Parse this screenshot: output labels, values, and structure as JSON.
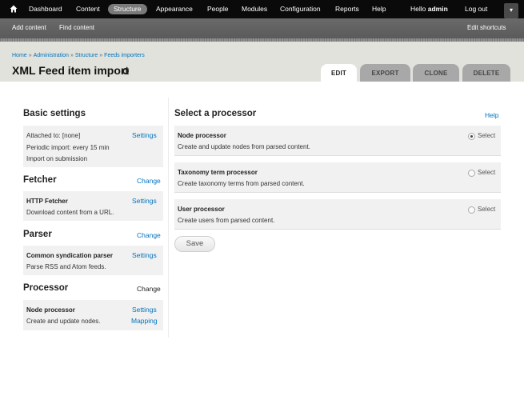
{
  "toolbar": {
    "items": [
      "Dashboard",
      "Content",
      "Structure",
      "Appearance",
      "People",
      "Modules",
      "Configuration",
      "Reports",
      "Help"
    ],
    "greeting_prefix": "Hello ",
    "username": "admin",
    "logout": "Log out",
    "home_icon": "home-icon",
    "toggle_icon": "chevron-down-icon"
  },
  "shortcuts": {
    "items": [
      "Add content",
      "Find content"
    ],
    "edit": "Edit shortcuts"
  },
  "breadcrumb": [
    "Home",
    "Administration",
    "Structure",
    "Feeds importers"
  ],
  "breadcrumb_sep": "»",
  "page_title": "XML Feed item import",
  "tabs": [
    "EDIT",
    "EXPORT",
    "CLONE",
    "DELETE"
  ],
  "basic": {
    "title": "Basic settings",
    "lines": [
      "Attached to: [none]",
      "Periodic import: every 15 min",
      "Import on submission"
    ],
    "settings": "Settings"
  },
  "fetcher": {
    "title": "Fetcher",
    "change": "Change",
    "name": "HTTP Fetcher",
    "desc": "Download content from a URL.",
    "settings": "Settings"
  },
  "parser": {
    "title": "Parser",
    "change": "Change",
    "name": "Common syndication parser",
    "desc": "Parse RSS and Atom feeds.",
    "settings": "Settings"
  },
  "processor": {
    "title": "Processor",
    "change": "Change",
    "name": "Node processor",
    "desc": "Create and update nodes.",
    "settings": "Settings",
    "mapping": "Mapping"
  },
  "select": {
    "title": "Select a processor",
    "help": "Help",
    "options": [
      {
        "name": "Node processor",
        "desc": "Create and update nodes from parsed content.",
        "label": "Select",
        "checked": true
      },
      {
        "name": "Taxonomy term processor",
        "desc": "Create taxonomy terms from parsed content.",
        "label": "Select",
        "checked": false
      },
      {
        "name": "User processor",
        "desc": "Create users from parsed content.",
        "label": "Select",
        "checked": false
      }
    ],
    "save": "Save"
  },
  "colors": {
    "link": "#0074bd",
    "toolbar_bg": "#0a0a0a",
    "header_bg": "#e1e2dc",
    "box_bg": "#f1f1f1"
  }
}
